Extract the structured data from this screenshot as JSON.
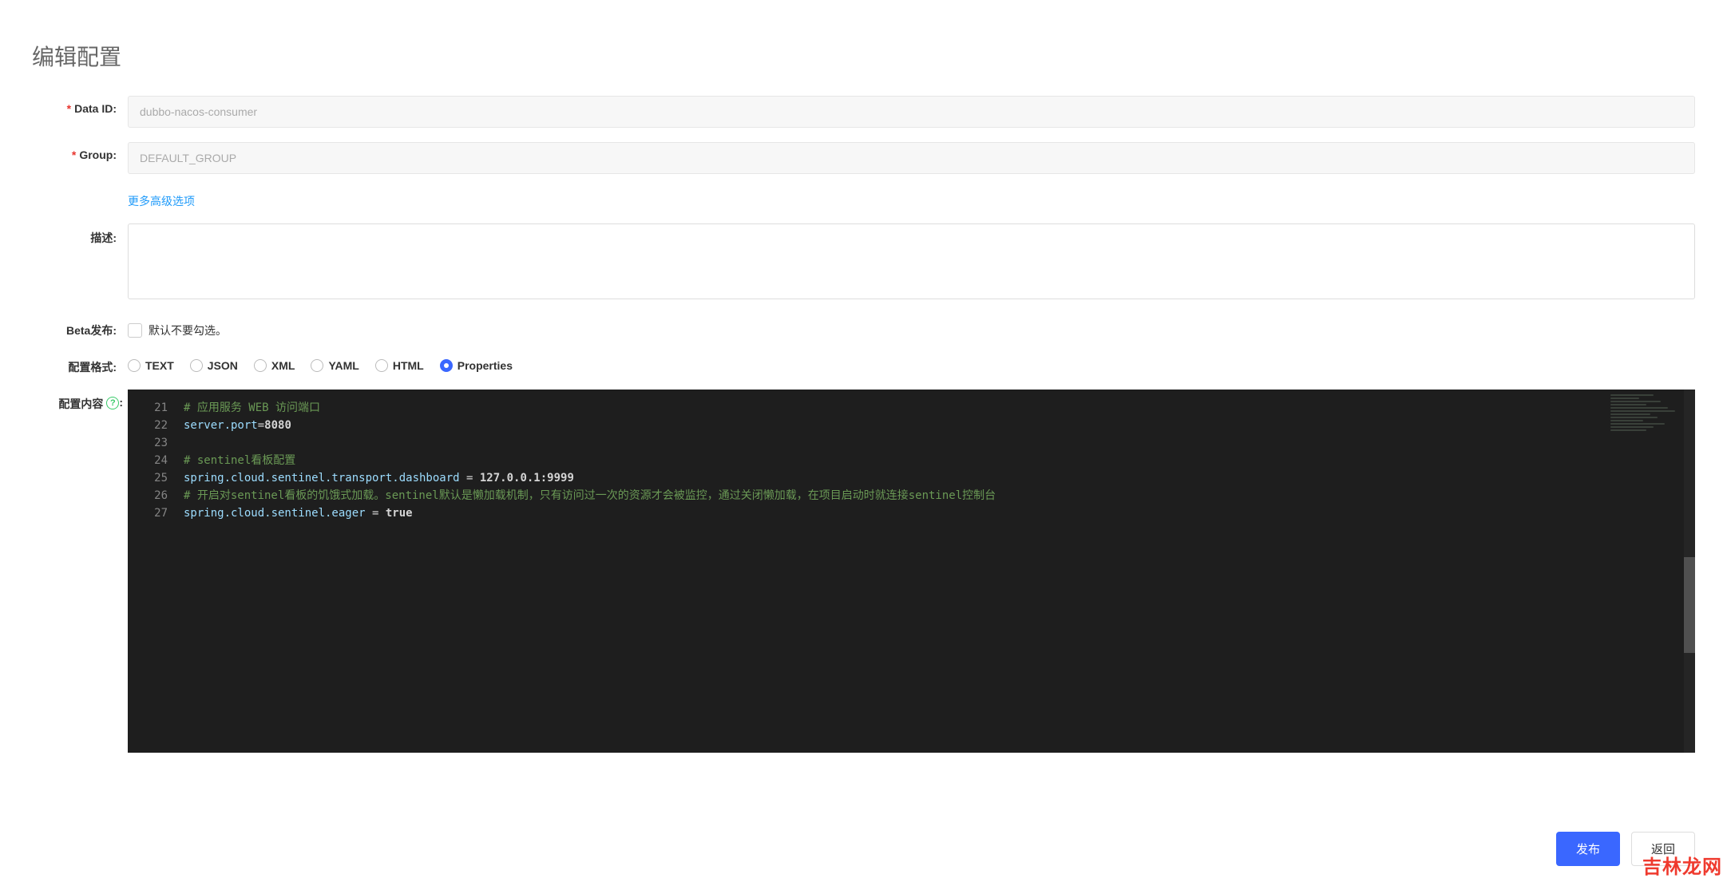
{
  "page": {
    "title": "编辑配置"
  },
  "form": {
    "dataId": {
      "label": "Data ID:",
      "value": "dubbo-nacos-consumer"
    },
    "group": {
      "label": "Group:",
      "value": "DEFAULT_GROUP"
    },
    "advancedLink": "更多高级选项",
    "description": {
      "label": "描述:",
      "value": ""
    },
    "beta": {
      "label": "Beta发布:",
      "hint": "默认不要勾选。",
      "checked": false
    },
    "format": {
      "label": "配置格式:",
      "options": [
        {
          "key": "text",
          "label": "TEXT"
        },
        {
          "key": "json",
          "label": "JSON"
        },
        {
          "key": "xml",
          "label": "XML"
        },
        {
          "key": "yaml",
          "label": "YAML"
        },
        {
          "key": "html",
          "label": "HTML"
        },
        {
          "key": "properties",
          "label": "Properties"
        }
      ],
      "selected": "properties"
    },
    "content": {
      "label": "配置内容",
      "colon": ":"
    }
  },
  "editor": {
    "startLine": 21,
    "lines": [
      {
        "type": "comment",
        "text": "# 应用服务 WEB 访问端口"
      },
      {
        "type": "kv",
        "key": "server.port",
        "eq": "=",
        "val": "8080"
      },
      {
        "type": "blank",
        "text": ""
      },
      {
        "type": "comment",
        "text": "# sentinel看板配置"
      },
      {
        "type": "kv",
        "key": "spring.cloud.sentinel.transport.dashboard",
        "eq": " = ",
        "val": "127.0.0.1:9999"
      },
      {
        "type": "comment",
        "text": "# 开启对sentinel看板的饥饿式加载。sentinel默认是懒加载机制，只有访问过一次的资源才会被监控，通过关闭懒加载，在项目启动时就连接sentinel控制台"
      },
      {
        "type": "kv",
        "key": "spring.cloud.sentinel.eager",
        "eq": " = ",
        "val": "true"
      }
    ]
  },
  "footer": {
    "publish": "发布",
    "back": "返回"
  },
  "watermark": "吉林龙网"
}
